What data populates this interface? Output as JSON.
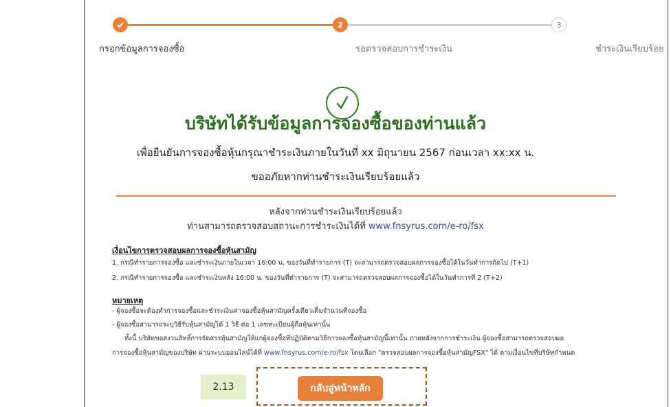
{
  "stepper": {
    "steps": [
      {
        "label": "กรอกข้อมูลการจองซื้อ",
        "state": "done"
      },
      {
        "number": "2",
        "label": "รอตรวจสอบการชำระเงิน",
        "state": "current"
      },
      {
        "number": "3",
        "label": "ชำระเงินเรียบร้อย",
        "state": "pending"
      }
    ]
  },
  "confirmation": {
    "title": "บริษัทได้รับข้อมูลการจองซื้อของท่านแล้ว",
    "deadline": "เพื่อยืนยันการจองซื้อหุ้นกรุณาชำระเงินภายในวันที่ xx มิถุนายน 2567 ก่อนเวลา xx:xx น.",
    "apology": "ขออภัยหากท่านชำระเงินเรียบร้อยแล้ว"
  },
  "after_payment": {
    "line1": "หลังจากท่านชำระเงินเรียบร้อยแล้ว",
    "line2_prefix": "ท่านสามารถตรวจสอบสถานะการชำระเงินได้ที่",
    "link": "www.fnsyrus.com/e-ro/fsx"
  },
  "conditions": {
    "heading": "เงื่อนไขการตรวจสอบผลการจองซื้อหุ้นสามัญ",
    "items": [
      "1. กรณีทำรายการจองซื้อ และชำระเงินภายในเวลา 16:00 น. ของวันที่ทำรายการ (T) จะสามารถตรวจสอบผลการจองซื้อได้ในวันทำการถัดไป (T+1)",
      "2. กรณีทำรายการจองซื้อ และชำระเงินหลัง 16:00 น. ของวันที่ทำรายการ (T) จะสามารถตรวจสอบผลการจองซื้อได้ในวันทำการที่ 2 (T+2)"
    ]
  },
  "notes": {
    "heading": "หมายเหตุ",
    "items": [
      "- ผู้จองซื้อจะต้องทำการจองซื้อและชำระเงินค่าจองซื้อหุ้นสามัญครั้งเดียวเต็มจำนวนที่จองซื้อ",
      "- ผู้จองซื้อสามารถระบุวิธีรับหุ้นสามัญได้ 1 วิธี ต่อ 1 เลขทะเบียนผู้ถือหุ้นเท่านั้น",
      "ทั้งนี้ บริษัทขอสงวนสิทธิ์การจัดสรรหุ้นสามัญให้แก่ผู้จองซื้อที่ปฏิบัติตามวิธีการจองซื้อหุ้นสามัญนี้เท่านั้น ภายหลังจากการชำระเงิน ผู้จองซื้อสามารถตรวจสอบผล"
    ],
    "last_prefix": "การจองซื้อหุ้นสามัญของบริษัท ผ่านระบบออนไลน์ได้ที่",
    "last_link": "www.fnsyrus.com/e-ro/fsx",
    "last_suffix": "โดยเลือก \"ตรวจสอบผลการจองซื้อหุ้นสามัญFSX\" ได้ ตามเงื่อนไขที่บริษัทกำหนด"
  },
  "annotation": {
    "badge": "2.13"
  },
  "actions": {
    "home_label": "กลับสู่หน้าหลัก"
  },
  "colors": {
    "accent": "#e8803a",
    "success": "#2f6e23",
    "link": "#2c4da0"
  }
}
